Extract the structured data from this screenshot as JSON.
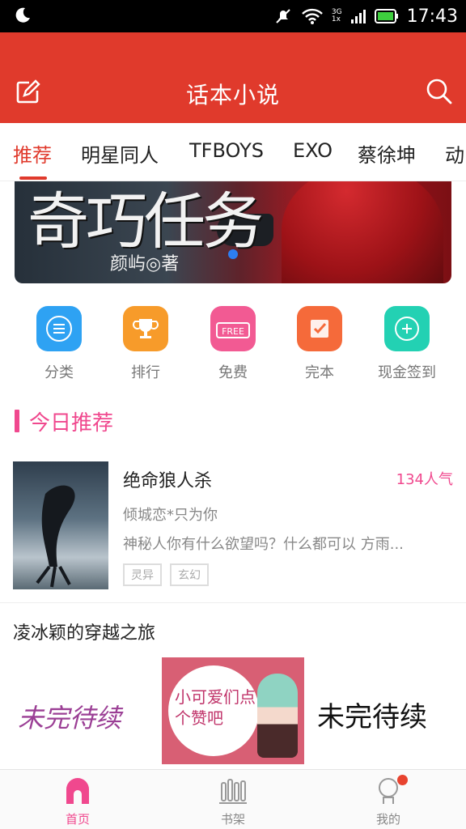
{
  "statusbar": {
    "time": "17:43",
    "network_top": "3G",
    "network_bottom": "1x"
  },
  "header": {
    "title": "话本小说"
  },
  "tabs": [
    {
      "label": "推荐",
      "active": true
    },
    {
      "label": "明星同人"
    },
    {
      "label": "TFBOYS"
    },
    {
      "label": "EXO"
    },
    {
      "label": "蔡徐坤"
    },
    {
      "label": "动"
    }
  ],
  "banner": {
    "title": "奇巧任务",
    "author": "颜屿◎著"
  },
  "quick_actions": [
    {
      "label": "分类",
      "icon": "list-icon",
      "color": "#2ea2f3"
    },
    {
      "label": "排行",
      "icon": "trophy-icon",
      "color": "#f79b2a"
    },
    {
      "label": "免费",
      "icon": "free-icon",
      "color": "#f25a93"
    },
    {
      "label": "完本",
      "icon": "finished-icon",
      "color": "#f56a3a"
    },
    {
      "label": "现金签到",
      "icon": "checkin-icon",
      "color": "#23d1b3"
    }
  ],
  "today_section": {
    "title": "今日推荐"
  },
  "book": {
    "title": "绝命狼人杀",
    "popularity": "134人气",
    "author": "倾城恋*只为你",
    "description": "神秘人你有什么欲望吗？什么都可以 方雨...",
    "tags": [
      "灵异",
      "玄幻"
    ]
  },
  "lower_section": {
    "title": "凌冰颖的穿越之旅",
    "thumbs": [
      {
        "text": "未完待续"
      },
      {
        "text": "小可爱们点个赞吧"
      },
      {
        "text": "未完待续"
      }
    ]
  },
  "bottom_nav": [
    {
      "label": "首页",
      "icon": "home-icon",
      "active": true
    },
    {
      "label": "书架",
      "icon": "bookshelf-icon"
    },
    {
      "label": "我的",
      "icon": "profile-icon"
    }
  ],
  "colors": {
    "brand_red": "#e03a2c",
    "pink": "#f0488e"
  }
}
